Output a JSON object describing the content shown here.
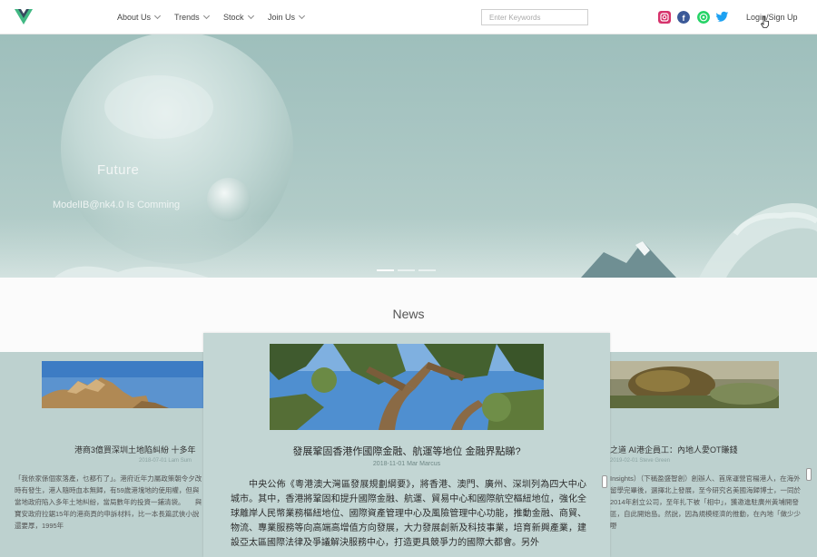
{
  "header": {
    "nav": [
      {
        "label": "About Us"
      },
      {
        "label": "Trends"
      },
      {
        "label": "Stock"
      },
      {
        "label": "Join Us"
      }
    ],
    "search_placeholder": "Enter Keywords",
    "login_label": "Login/Sign Up",
    "social": [
      "instagram-icon",
      "facebook-icon",
      "whatsapp-icon",
      "twitter-icon"
    ]
  },
  "hero": {
    "title": "Future",
    "subtitle": "ModelIB@nk4.0 Is Comming",
    "slides": 3,
    "active_slide": 1
  },
  "news": {
    "heading": "News",
    "cards": [
      {
        "title": "港商3億買深圳土地陷糾紛 十多年",
        "meta": "2018-07-01 Lam Sum",
        "text": "「我依家係個家落產，乜都冇了」。港府近年力屬政策朝令夕改時有發生，港人隨時血本無歸，有59歲港塊地的使用權，但與當地政府陷入多年土地糾紛，當局數年的投資一鋪清袋。　　與寶安政府拉鋸15年的港商頁的申訴材料，比一本長篇武俠小說還要厚，1995年"
      },
      {
        "title": "之道 AI港企員工：內地人愛OT賺錢",
        "meta": "2019-02-01 Steve Green",
        "text": "Insights）（下稱盈盛智創）創辦人、首席運營官楊港人，在海外留學完畢後，選擇北上發展，至今研究名美國海歸博士，一同於2014年創立公司，至年扎下被「相中」，獲邀進駐廣州黃埔開發區，自此開始島。然說，因為規模經濟的推動，在內地「做少少嘢"
      }
    ]
  },
  "modal": {
    "title": "發展鞏固香港作國際金融、航運等地位 金融界點睇?",
    "meta": "2018-11-01 Mar Marcus",
    "body": "中央公佈《粵港澳大灣區發展規劃綱要》，將香港、澳門、廣州、深圳列為四大中心城市。其中，香港將鞏固和提升國際金融、航運、貿易中心和國際航空樞紐地位，強化全球離岸人民幣業務樞紐地位、國際資產管理中心及風險管理中心功能，推動金融、商貿、物流、專業服務等向高端高增值方向發展，大力發展創新及科技事業，培育新興產業，建設亞太區國際法律及爭議解決服務中心，打造更具競爭力的國際大都會。另外"
  },
  "colors": {
    "hero_sky": "#a9c6c3",
    "news_band": "#bdd1cf",
    "modal_bg": "#c3d6d4",
    "logo_green": "#41b883",
    "logo_dark": "#35495e"
  }
}
